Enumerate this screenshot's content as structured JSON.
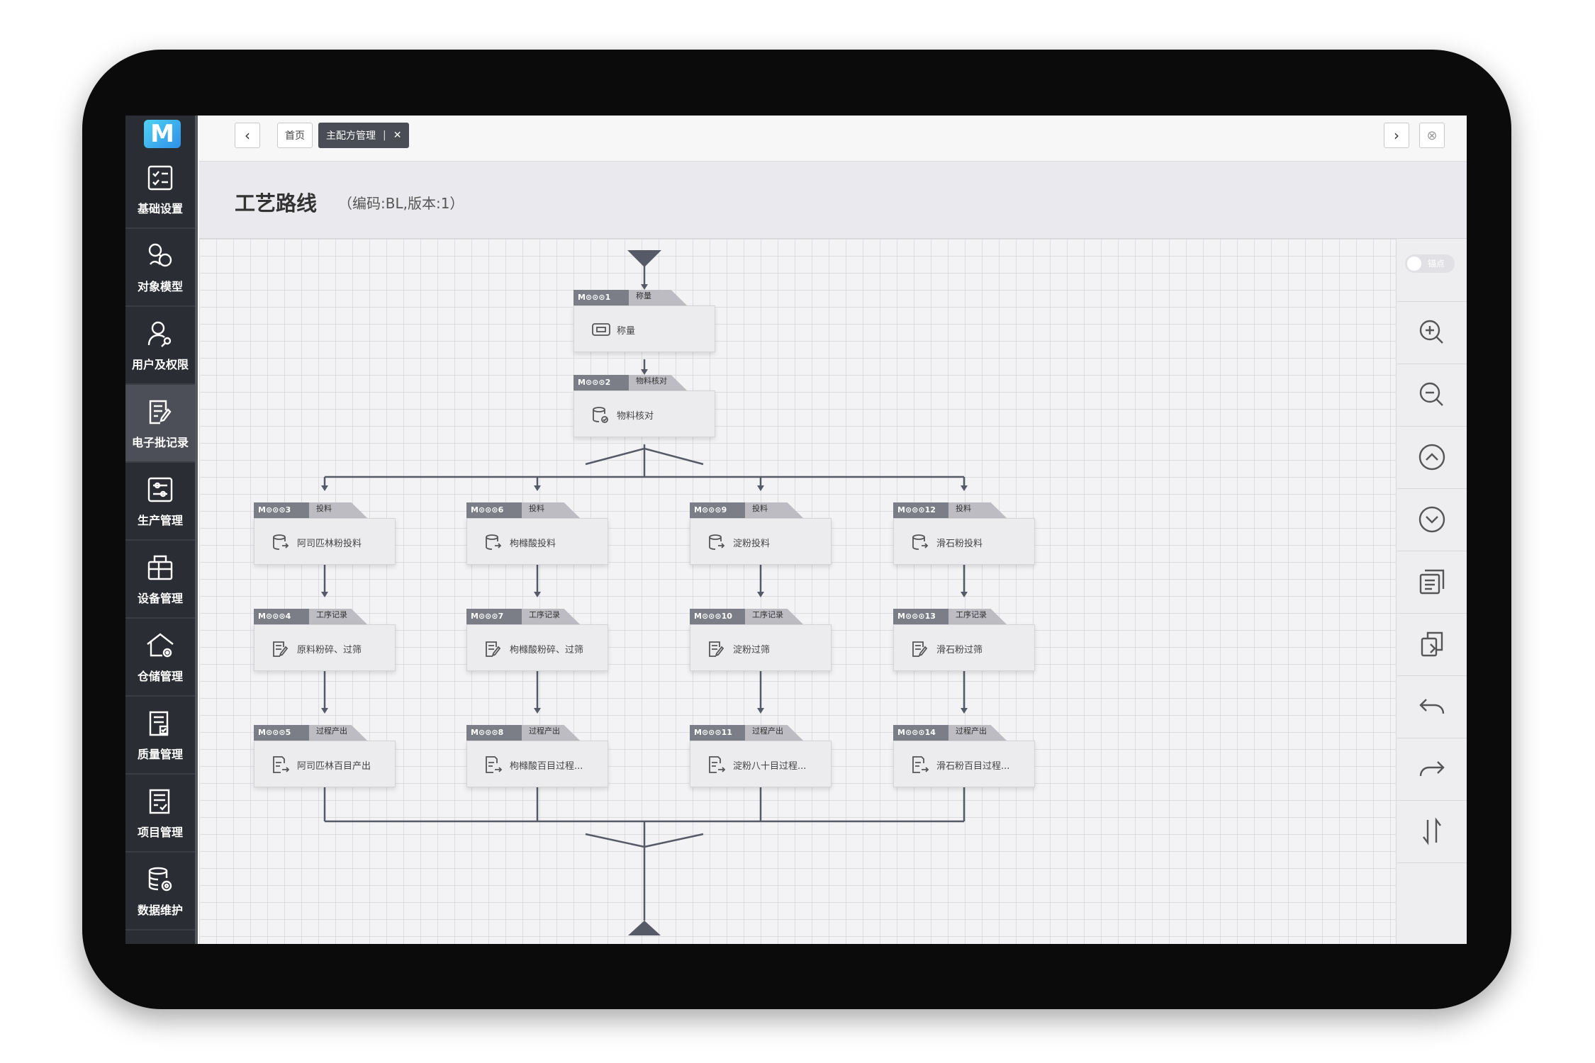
{
  "app": {
    "logo_letter": "M"
  },
  "sidebar": {
    "items": [
      {
        "label": "基础设置",
        "icon": "list-settings-icon"
      },
      {
        "label": "对象模型",
        "icon": "model-link-icon"
      },
      {
        "label": "用户及权限",
        "icon": "user-key-icon"
      },
      {
        "label": "电子批记录",
        "icon": "batch-record-icon",
        "active": true
      },
      {
        "label": "生产管理",
        "icon": "production-icon"
      },
      {
        "label": "设备管理",
        "icon": "equipment-icon"
      },
      {
        "label": "仓储管理",
        "icon": "warehouse-icon"
      },
      {
        "label": "质量管理",
        "icon": "quality-icon"
      },
      {
        "label": "项目管理",
        "icon": "project-icon"
      },
      {
        "label": "数据维护",
        "icon": "database-icon"
      }
    ]
  },
  "tabs": {
    "prev": "‹",
    "next": "›",
    "close_all": "⊗",
    "home_label": "首页",
    "active_label": "主配方管理",
    "active_close": "✕"
  },
  "header": {
    "title": "工艺路线",
    "subtitle": "（编码:BL,版本:1）"
  },
  "toolbox": {
    "toggle_label": "锚点",
    "tools": [
      "zoom-in-icon",
      "zoom-out-icon",
      "scroll-up-icon",
      "scroll-down-icon",
      "copy-list-icon",
      "paste-icon",
      "undo-icon",
      "redo-icon",
      "sort-icon"
    ]
  },
  "flow": {
    "nodes": [
      {
        "code": "M⊙⊙⊙1",
        "type": "称量",
        "label": "称量",
        "icon": "scale"
      },
      {
        "code": "M⊙⊙⊙2",
        "type": "物料核对",
        "label": "物料核对",
        "icon": "check"
      },
      {
        "code": "M⊙⊙⊙3",
        "type": "投料",
        "label": "阿司匹林粉投料",
        "icon": "feed"
      },
      {
        "code": "M⊙⊙⊙6",
        "type": "投料",
        "label": "枸橼酸投料",
        "icon": "feed"
      },
      {
        "code": "M⊙⊙⊙9",
        "type": "投料",
        "label": "淀粉投料",
        "icon": "feed"
      },
      {
        "code": "M⊙⊙⊙12",
        "type": "投料",
        "label": "滑石粉投料",
        "icon": "feed"
      },
      {
        "code": "M⊙⊙⊙4",
        "type": "工序记录",
        "label": "原料粉碎、过筛",
        "icon": "record"
      },
      {
        "code": "M⊙⊙⊙7",
        "type": "工序记录",
        "label": "枸橼酸粉碎、过筛",
        "icon": "record"
      },
      {
        "code": "M⊙⊙⊙10",
        "type": "工序记录",
        "label": "淀粉过筛",
        "icon": "record"
      },
      {
        "code": "M⊙⊙⊙13",
        "type": "工序记录",
        "label": "滑石粉过筛",
        "icon": "record"
      },
      {
        "code": "M⊙⊙⊙5",
        "type": "过程产出",
        "label": "阿司匹林百目产出",
        "icon": "output"
      },
      {
        "code": "M⊙⊙⊙8",
        "type": "过程产出",
        "label": "枸橼酸百目过程...",
        "icon": "output"
      },
      {
        "code": "M⊙⊙⊙11",
        "type": "过程产出",
        "label": "淀粉八十目过程...",
        "icon": "output"
      },
      {
        "code": "M⊙⊙⊙14",
        "type": "过程产出",
        "label": "滑石粉百目过程...",
        "icon": "output"
      }
    ]
  },
  "colors": {
    "sidebar": "#2a2d34",
    "active_tab": "#4a4d55",
    "line": "#555a66"
  }
}
